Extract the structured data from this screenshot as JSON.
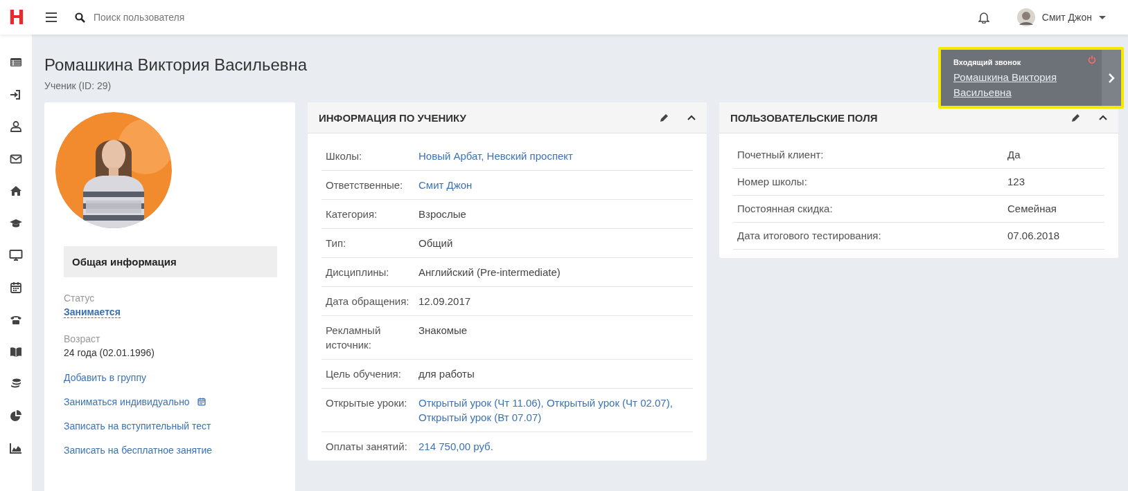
{
  "topbar": {
    "logo": "H",
    "search": {
      "placeholder": "Поиск пользователя"
    },
    "user": "Смит Джон"
  },
  "sidebar": {
    "items": [
      {
        "kind": "list"
      },
      {
        "kind": "signin"
      },
      {
        "kind": "user"
      },
      {
        "kind": "mail"
      },
      {
        "kind": "home"
      },
      {
        "kind": "cap"
      },
      {
        "kind": "monitor"
      },
      {
        "kind": "calendar"
      },
      {
        "kind": "phone"
      },
      {
        "kind": "book"
      },
      {
        "kind": "coins"
      },
      {
        "kind": "pie"
      },
      {
        "kind": "chart"
      }
    ]
  },
  "page": {
    "title": "Ромашкина Виктория Васильевна",
    "subtitle": "Ученик (ID: 29)"
  },
  "profile": {
    "section": "Общая информация",
    "fields": [
      {
        "label": "Статус",
        "value": "Занимается",
        "kind": "status"
      },
      {
        "label": "Возраст",
        "value": "24 года (02.01.1996)",
        "kind": "text"
      }
    ],
    "actions": [
      {
        "label": "Добавить в группу",
        "icon": false
      },
      {
        "label": "Заниматься индивидуально",
        "icon": true
      },
      {
        "label": "Записать на вступительный тест",
        "icon": false
      },
      {
        "label": "Записать на бесплатное занятие",
        "icon": false
      }
    ]
  },
  "info": {
    "title": "ИНФОРМАЦИЯ ПО УЧЕНИКУ",
    "rows": [
      {
        "label": "Школы:",
        "value": "Новый Арбат, Невский проспект",
        "kind": "link"
      },
      {
        "label": "Ответственные:",
        "value": "Смит Джон",
        "kind": "link"
      },
      {
        "label": "Категория:",
        "value": "Взрослые",
        "kind": "text"
      },
      {
        "label": "Тип:",
        "value": "Общий",
        "kind": "text"
      },
      {
        "label": "Дисциплины:",
        "value": "Английский (Pre-intermediate)",
        "kind": "text"
      },
      {
        "label": "Дата обращения:",
        "value": "12.09.2017",
        "kind": "text"
      },
      {
        "label": "Рекламный источник:",
        "value": "Знакомые",
        "kind": "text"
      },
      {
        "label": "Цель обучения:",
        "value": "для работы",
        "kind": "text"
      },
      {
        "label": "Открытые уроки:",
        "value": "Открытый урок (Чт 11.06), Открытый урок (Чт 02.07), Открытый урок (Вт 07.07)",
        "kind": "link"
      },
      {
        "label": "Оплаты занятий:",
        "value": "214 750,00 руб.",
        "kind": "link"
      }
    ]
  },
  "custom": {
    "title": "ПОЛЬЗОВАТЕЛЬСКИЕ ПОЛЯ",
    "rows": [
      {
        "label": "Почетный клиент:",
        "value": "Да"
      },
      {
        "label": "Номер школы:",
        "value": "123"
      },
      {
        "label": "Постоянная скидка:",
        "value": "Семейная"
      },
      {
        "label": "Дата итогового тестирования:",
        "value": "07.06.2018"
      }
    ]
  },
  "call": {
    "title": "Входящий звонок",
    "caller": "Ромашкина Виктория Васильевна"
  }
}
